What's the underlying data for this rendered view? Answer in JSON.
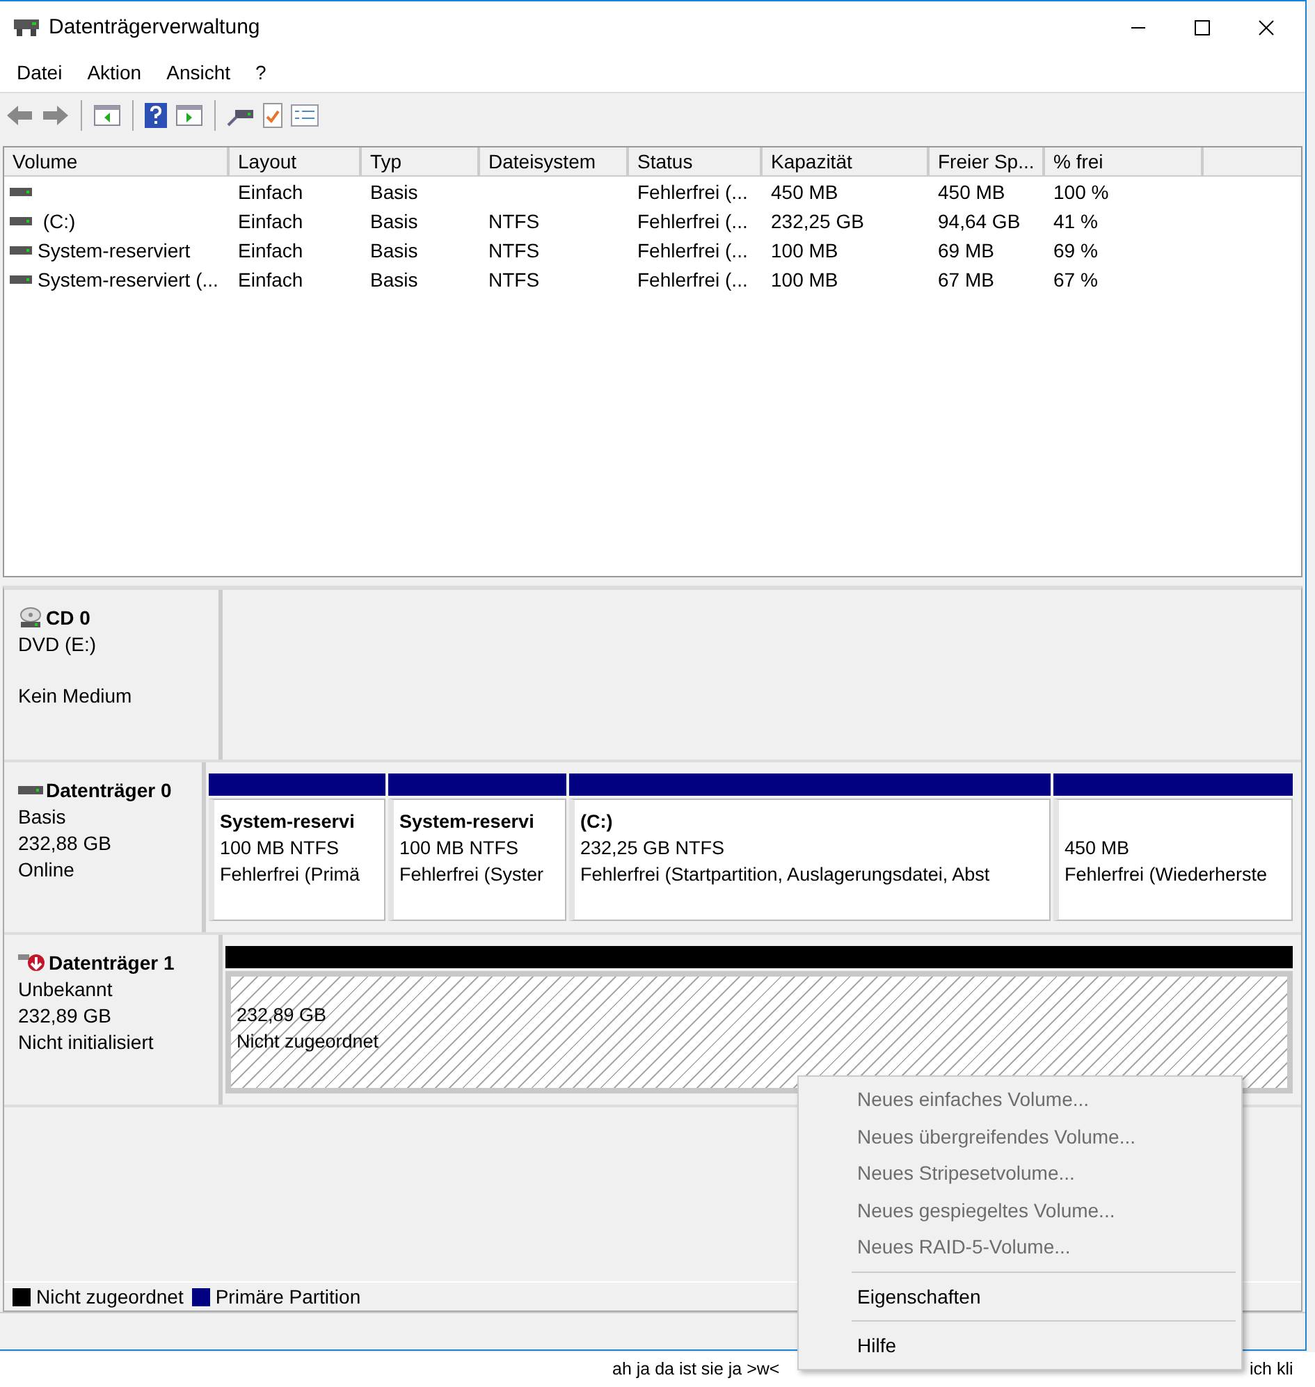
{
  "window": {
    "title": "Datenträgerverwaltung"
  },
  "menu": [
    "Datei",
    "Aktion",
    "Ansicht",
    "?"
  ],
  "table": {
    "columns": [
      "Volume",
      "Layout",
      "Typ",
      "Dateisystem",
      "Status",
      "Kapazität",
      "Freier Sp...",
      "% frei"
    ],
    "rows": [
      {
        "cells": [
          "",
          "Einfach",
          "Basis",
          "",
          "Fehlerfrei (...",
          "450 MB",
          "450 MB",
          "100 %"
        ]
      },
      {
        "cells": [
          " (C:)",
          "Einfach",
          "Basis",
          "NTFS",
          "Fehlerfrei (...",
          "232,25 GB",
          "94,64 GB",
          "41 %"
        ]
      },
      {
        "cells": [
          "System-reserviert",
          "Einfach",
          "Basis",
          "NTFS",
          "Fehlerfrei (...",
          "100 MB",
          "69 MB",
          "69 %"
        ]
      },
      {
        "cells": [
          "System-reserviert (...",
          "Einfach",
          "Basis",
          "NTFS",
          "Fehlerfrei (...",
          "100 MB",
          "67 MB",
          "67 %"
        ]
      }
    ]
  },
  "disks": [
    {
      "kind": "cdrom",
      "name": "CD 0",
      "lines": [
        "DVD (E:)",
        "Kein Medium"
      ]
    },
    {
      "kind": "basic",
      "name": "Datenträger 0",
      "lines": [
        "Basis",
        "232,88 GB",
        "Online"
      ],
      "partitions": [
        {
          "kind": "primary",
          "title": "System-reservi",
          "lines": [
            "100 MB NTFS",
            "Fehlerfrei (Primä"
          ]
        },
        {
          "kind": "primary",
          "title": "System-reservi",
          "lines": [
            "100 MB NTFS",
            "Fehlerfrei (Syster"
          ]
        },
        {
          "kind": "primary",
          "title": " (C:)",
          "lines": [
            "232,25 GB NTFS",
            "Fehlerfrei (Startpartition, Auslagerungsdatei, Abst"
          ]
        },
        {
          "kind": "primary",
          "lines": [
            "450 MB",
            "Fehlerfrei (Wiederherste"
          ]
        }
      ]
    },
    {
      "kind": "unknown",
      "name": "Datenträger 1",
      "lines": [
        "Unbekannt",
        "232,89 GB",
        "Nicht initialisiert"
      ],
      "partitions": [
        {
          "kind": "unallocated",
          "lines": [
            "232,89 GB",
            "Nicht zugeordnet"
          ]
        }
      ]
    }
  ],
  "legend": [
    {
      "label": "Nicht zugeordnet",
      "color": "#000000"
    },
    {
      "label": "Primäre Partition",
      "color": "#000080"
    }
  ],
  "context_menu": [
    {
      "kind": "item",
      "label": "Neues einfaches Volume...",
      "disabled": true
    },
    {
      "kind": "item",
      "label": "Neues übergreifendes Volume...",
      "disabled": true
    },
    {
      "kind": "item",
      "label": "Neues Stripesetvolume...",
      "disabled": true
    },
    {
      "kind": "item",
      "label": "Neues gespiegeltes Volume...",
      "disabled": true
    },
    {
      "kind": "item",
      "label": "Neues RAID-5-Volume...",
      "disabled": true
    },
    {
      "kind": "separator"
    },
    {
      "kind": "item",
      "label": "Eigenschaften",
      "disabled": false
    },
    {
      "kind": "separator"
    },
    {
      "kind": "item",
      "label": "Hilfe",
      "disabled": false
    }
  ],
  "background_text": [
    "ah ja da ist sie ja >w<",
    "ich kli"
  ]
}
